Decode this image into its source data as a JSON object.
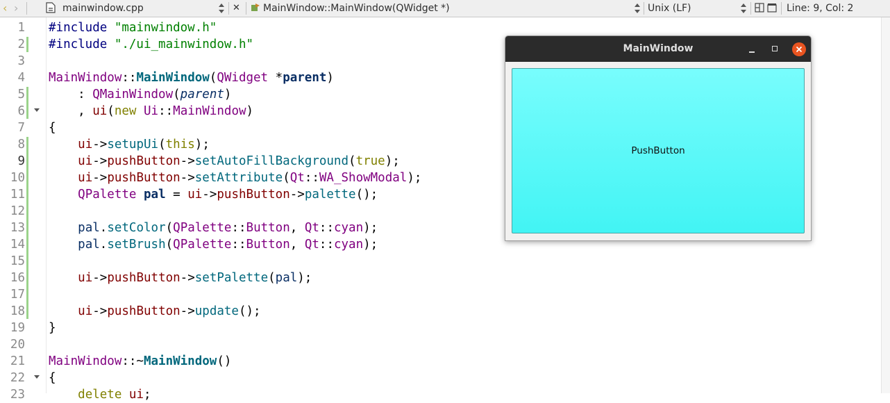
{
  "toolbar": {
    "file_name": "mainwindow.cpp",
    "symbol": "MainWindow::MainWindow(QWidget *)",
    "line_ending": "Unix (LF)",
    "position": "Line: 9, Col: 2"
  },
  "editor": {
    "line_numbers": [
      "1",
      "2",
      "3",
      "4",
      "5",
      "6",
      "7",
      "8",
      "9",
      "10",
      "11",
      "12",
      "13",
      "14",
      "15",
      "16",
      "17",
      "18",
      "19",
      "20",
      "21",
      "22",
      "23"
    ],
    "current_line": 9,
    "modified_lines": [
      2,
      5,
      6,
      8,
      9,
      10,
      11,
      12,
      13,
      14,
      15,
      16,
      17,
      18
    ],
    "fold_markers": [
      6,
      21
    ]
  },
  "code": {
    "l1": {
      "a": "#include ",
      "b": "\"mainwindow.h\""
    },
    "l2": {
      "a": "#include ",
      "b": "\"./ui_mainwindow.h\""
    },
    "l4": {
      "a": "MainWindow",
      "b": "::",
      "c": "MainWindow",
      "d": "(",
      "e": "QWidget",
      "f": " *",
      "g": "parent",
      "h": ")"
    },
    "l5": {
      "a": "    : ",
      "b": "QMainWindow",
      "c": "(",
      "d": "parent",
      "e": ")"
    },
    "l6": {
      "a": "    , ",
      "b": "ui",
      "c": "(",
      "d": "new",
      "e": " ",
      "f": "Ui",
      "g": "::",
      "h": "MainWindow",
      "i": ")"
    },
    "l7": {
      "a": "{"
    },
    "l8": {
      "a": "    ",
      "b": "ui",
      "c": "->",
      "d": "setupUi",
      "e": "(",
      "f": "this",
      "g": ");"
    },
    "l9": {
      "a": "    ",
      "b": "ui",
      "c": "->",
      "d": "pushButton",
      "e": "->",
      "f": "setAutoFillBackground",
      "g": "(",
      "h": "true",
      "i": ");"
    },
    "l10": {
      "a": "    ",
      "b": "ui",
      "c": "->",
      "d": "pushButton",
      "e": "->",
      "f": "setAttribute",
      "g": "(",
      "h": "Qt",
      "i": "::",
      "j": "WA_ShowModal",
      "k": ");"
    },
    "l11": {
      "a": "    ",
      "b": "QPalette",
      "c": " ",
      "d": "pal",
      "e": " = ",
      "f": "ui",
      "g": "->",
      "h": "pushButton",
      "i": "->",
      "j": "palette",
      "k": "();"
    },
    "l13": {
      "a": "    ",
      "b": "pal",
      "c": ".",
      "d": "setColor",
      "e": "(",
      "f": "QPalette",
      "g": "::",
      "h": "Button",
      "i": ", ",
      "j": "Qt",
      "k": "::",
      "l": "cyan",
      "m": ");"
    },
    "l14": {
      "a": "    ",
      "b": "pal",
      "c": ".",
      "d": "setBrush",
      "e": "(",
      "f": "QPalette",
      "g": "::",
      "h": "Button",
      "i": ", ",
      "j": "Qt",
      "k": "::",
      "l": "cyan",
      "m": ");"
    },
    "l16": {
      "a": "    ",
      "b": "ui",
      "c": "->",
      "d": "pushButton",
      "e": "->",
      "f": "setPalette",
      "g": "(",
      "h": "pal",
      "i": ");"
    },
    "l18": {
      "a": "    ",
      "b": "ui",
      "c": "->",
      "d": "pushButton",
      "e": "->",
      "f": "update",
      "g": "();"
    },
    "l19": {
      "a": "}"
    },
    "l21": {
      "a": "MainWindow",
      "b": "::~",
      "c": "MainWindow",
      "d": "()"
    },
    "l22": {
      "a": "{"
    },
    "l23": {
      "a": "    ",
      "b": "delete",
      "c": " ",
      "d": "ui",
      "e": ";"
    }
  },
  "window": {
    "title": "MainWindow",
    "button_label": "PushButton",
    "button_color": "#55ffff",
    "close_color": "#e95420"
  }
}
